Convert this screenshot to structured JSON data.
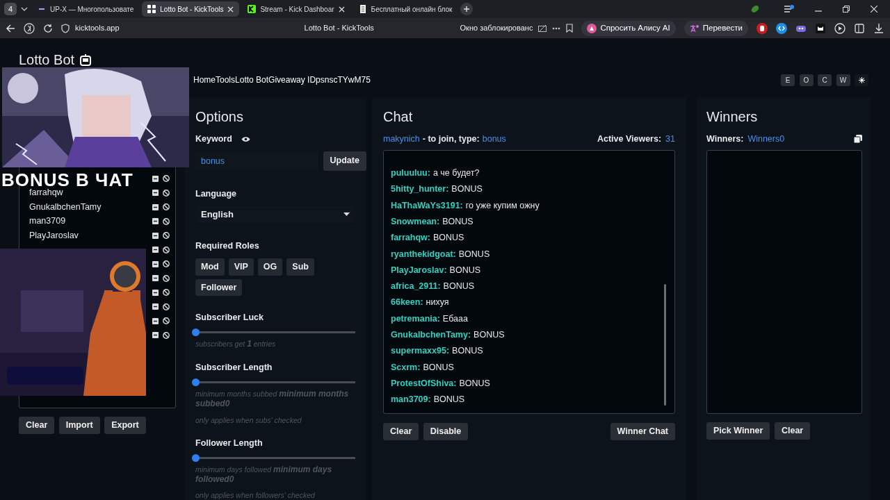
{
  "browser": {
    "tab_count": "4",
    "tabs": [
      {
        "title": "UP-X — Многопользовате",
        "selected": false,
        "closable": false
      },
      {
        "title": "Lotto Bot - KickTools",
        "selected": true,
        "closable": true
      },
      {
        "title": "Stream - Kick Dashboar",
        "selected": false,
        "closable": true
      },
      {
        "title": "Бесплатный онлайн блок",
        "selected": false,
        "closable": false
      }
    ],
    "address": "kicktools.app",
    "page_title": "Lotto Bot - KickTools",
    "blocked_notice": "Окно заблокированс",
    "alice_button": "Спросить Алису AI",
    "translate_button": "Перевести"
  },
  "header": {
    "title": "Lotto Bot",
    "breadcrumb": [
      "Home",
      "Tools",
      "Lotto Bot",
      "Giveaway ID",
      "psnscTYwM75"
    ],
    "theme_buttons": [
      "E",
      "O",
      "C",
      "W"
    ]
  },
  "overlay_text": "BONUS В ЧАТ",
  "entrants": [
    {
      "kind": "covered"
    },
    {
      "kind": "entry",
      "name": "farrahqw"
    },
    {
      "kind": "entry",
      "name": "GnukalbchenTamy"
    },
    {
      "kind": "entry",
      "name": "man3709"
    },
    {
      "kind": "entry",
      "name": "PlayJaroslav"
    },
    {
      "kind": "covered"
    },
    {
      "kind": "covered"
    },
    {
      "kind": "covered"
    },
    {
      "kind": "covered"
    },
    {
      "kind": "covered"
    },
    {
      "kind": "covered"
    },
    {
      "kind": "covered"
    }
  ],
  "entrant_buttons": [
    "Clear",
    "Import",
    "Export"
  ],
  "options": {
    "title": "Options",
    "keyword": {
      "label": "Keyword",
      "value": "bonus",
      "button": "Update"
    },
    "language": {
      "label": "Language",
      "value": "English"
    },
    "roles": {
      "label": "Required Roles",
      "items": [
        {
          "label": "Mod",
          "selected": false
        },
        {
          "label": "VIP",
          "selected": false
        },
        {
          "label": "OG",
          "selected": false
        },
        {
          "label": "Sub",
          "selected": false
        },
        {
          "label": "Follower",
          "selected": false
        }
      ]
    },
    "sliders": [
      {
        "label": "Subscriber Luck",
        "level": 0,
        "help": "subscribers get **1** entries"
      },
      {
        "label": "Subscriber Length",
        "level": 0,
        "help": "minimum months subbed **minimum months subbed0**",
        "note": "only applies when subs' checked"
      },
      {
        "label": "Follower Length",
        "level": 0,
        "help": "minimum days followed **minimum days followed0**",
        "note": "only applies when followers' checked"
      }
    ]
  },
  "chat": {
    "title": "Chat",
    "channel": "makynich",
    "join_text": "- to join, type:",
    "keyword": "bonus",
    "viewers_label": "Active Viewers:",
    "viewers": "31",
    "messages": [
      {
        "user": "puluuluu:",
        "text": "а че будет?"
      },
      {
        "user": "5hitty_hunter:",
        "text": "BONUS"
      },
      {
        "user": "HaThaWaYs3191:",
        "text": "го уже купим ожну"
      },
      {
        "user": "Snowmean:",
        "text": "BONUS"
      },
      {
        "user": "farrahqw:",
        "text": "BONUS"
      },
      {
        "user": "ryanthekidgoat:",
        "text": "BONUS"
      },
      {
        "user": "PlayJaroslav:",
        "text": "BONUS"
      },
      {
        "user": "africa_2911:",
        "text": "BONUS"
      },
      {
        "user": "66keen:",
        "text": "нихуя"
      },
      {
        "user": "petremania:",
        "text": "Ебааа"
      },
      {
        "user": "GnukalbchenTamy:",
        "text": "BONUS"
      },
      {
        "user": "supermaxx95:",
        "text": "BONUS"
      },
      {
        "user": "Scxrm:",
        "text": "BONUS"
      },
      {
        "user": "ProtestOfShiva:",
        "text": "BONUS"
      },
      {
        "user": "man3709:",
        "text": "BONUS"
      }
    ],
    "buttons": [
      "Clear",
      "Disable"
    ],
    "winner_button": "Winner Chat"
  },
  "winners": {
    "title": "Winners",
    "label": "Winners:",
    "value": "Winners0",
    "buttons": [
      "Pick Winner",
      "Clear"
    ]
  }
}
